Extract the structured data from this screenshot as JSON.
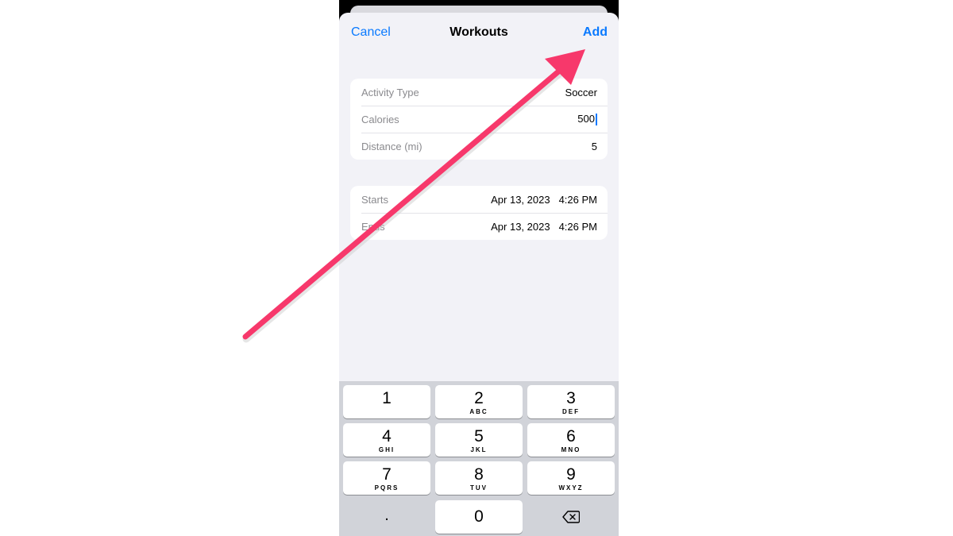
{
  "navbar": {
    "cancel_label": "Cancel",
    "title": "Workouts",
    "add_label": "Add"
  },
  "details": [
    {
      "label": "Activity Type",
      "value": "Soccer"
    },
    {
      "label": "Calories",
      "value": "500"
    },
    {
      "label": "Distance (mi)",
      "value": "5"
    }
  ],
  "times": [
    {
      "label": "Starts",
      "date": "Apr 13, 2023",
      "time": "4:26 PM"
    },
    {
      "label": "Ends",
      "date": "Apr 13, 2023",
      "time": "4:26 PM"
    }
  ],
  "keyboard": {
    "keys": [
      {
        "digit": "1",
        "letters": ""
      },
      {
        "digit": "2",
        "letters": "ABC"
      },
      {
        "digit": "3",
        "letters": "DEF"
      },
      {
        "digit": "4",
        "letters": "GHI"
      },
      {
        "digit": "5",
        "letters": "JKL"
      },
      {
        "digit": "6",
        "letters": "MNO"
      },
      {
        "digit": "7",
        "letters": "PQRS"
      },
      {
        "digit": "8",
        "letters": "TUV"
      },
      {
        "digit": "9",
        "letters": "WXYZ"
      }
    ],
    "dot": ".",
    "zero": "0",
    "backspace_icon": "backspace-icon"
  },
  "annotation": {
    "icon": "arrow-icon",
    "color": "#f7386b"
  },
  "colors": {
    "accent": "#0a7aff",
    "sheet_bg": "#f2f2f7",
    "keyboard_bg": "#d1d3d9"
  }
}
